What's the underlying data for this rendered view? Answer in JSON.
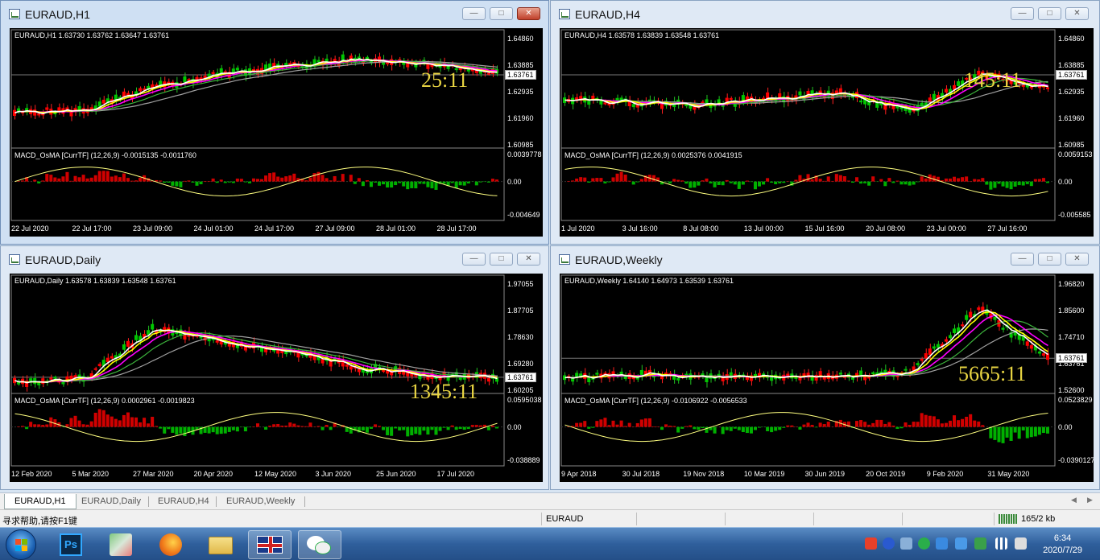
{
  "windows": [
    {
      "id": "h1",
      "title": "EURAUD,H1",
      "info": "EURAUD,H1  1.63730 1.63762 1.63647 1.63761",
      "prices": [
        "1.64860",
        "1.63885",
        "1.62935",
        "1.61960",
        "1.60985"
      ],
      "current_price": "1.63761",
      "timer": "25:11",
      "macd": "MACD_OsMA [CurrTF] (12,26,9) -0.0015135 -0.0011760",
      "macd_scale": [
        "0.0039778",
        "0.00",
        "-0.004649"
      ],
      "dates": [
        "22 Jul 2020",
        "22 Jul 17:00",
        "23 Jul 09:00",
        "24 Jul 01:00",
        "24 Jul 17:00",
        "27 Jul 09:00",
        "28 Jul 01:00",
        "28 Jul 17:00"
      ]
    },
    {
      "id": "h4",
      "title": "EURAUD,H4",
      "info": "EURAUD,H4  1.63578 1.63839 1.63548 1.63761",
      "prices": [
        "1.64860",
        "1.63885",
        "1.62935",
        "1.61960",
        "1.60985"
      ],
      "current_price": "1.63761",
      "timer": "145:11",
      "macd": "MACD_OsMA [CurrTF] (12,26,9) 0.0025376 0.0041915",
      "macd_scale": [
        "0.0059153",
        "0.00",
        "-0.005585"
      ],
      "dates": [
        "1 Jul 2020",
        "3 Jul 16:00",
        "8 Jul 08:00",
        "13 Jul 00:00",
        "15 Jul 16:00",
        "20 Jul 08:00",
        "23 Jul 00:00",
        "27 Jul 16:00"
      ]
    },
    {
      "id": "daily",
      "title": "EURAUD,Daily",
      "info": "EURAUD,Daily  1.63578 1.63839 1.63548 1.63761",
      "prices": [
        "1.97055",
        "1.87705",
        "1.78630",
        "1.69280",
        "1.60205"
      ],
      "current_price": "1.63761",
      "timer": "1345:11",
      "macd": "MACD_OsMA [CurrTF] (12,26,9) 0.0002961 -0.0019823",
      "macd_scale": [
        "0.0595038",
        "0.00",
        "-0.038889"
      ],
      "dates": [
        "12 Feb 2020",
        "5 Mar 2020",
        "27 Mar 2020",
        "20 Apr 2020",
        "12 May 2020",
        "3 Jun 2020",
        "25 Jun 2020",
        "17 Jul 2020"
      ]
    },
    {
      "id": "weekly",
      "title": "EURAUD,Weekly",
      "info": "EURAUD,Weekly  1.64140 1.64973 1.63539 1.63761",
      "prices": [
        "1.96820",
        "1.85600",
        "1.74710",
        "1.63761",
        "1.52600"
      ],
      "current_price": "1.63761",
      "timer": "5665:11",
      "macd": "MACD_OsMA [CurrTF] (12,26,9) -0.0106922 -0.0056533",
      "macd_scale": [
        "0.0523829",
        "0.00",
        "-0.0390127"
      ],
      "dates": [
        "9 Apr 2018",
        "30 Jul 2018",
        "19 Nov 2018",
        "10 Mar 2019",
        "30 Jun 2019",
        "20 Oct 2019",
        "9 Feb 2020",
        "31 May 2020"
      ]
    }
  ],
  "tabs": [
    "EURAUD,H1",
    "EURAUD,Daily",
    "EURAUD,H4",
    "EURAUD,Weekly"
  ],
  "status": {
    "help": "寻求帮助,请按F1键",
    "symbol": "EURAUD",
    "traffic": "165/2 kb"
  },
  "clock": {
    "time": "6:34",
    "date": "2020/7/29"
  },
  "taskbar_items": [
    "start-orb-icon",
    "photoshop-icon",
    "paint-tool-icon",
    "firefox-icon",
    "file-explorer-icon",
    "metatrader-flag-icon",
    "wechat-icon"
  ],
  "colors": {
    "bull": "#ff0000",
    "bear": "#00c800",
    "ma_fast": "#ffffff",
    "ma_yellow": "#ffff00",
    "ma_magenta": "#ff00ff",
    "ma_green": "#3cb43c",
    "ma_gray": "#a0a0a0",
    "timer": "#e8d442"
  }
}
